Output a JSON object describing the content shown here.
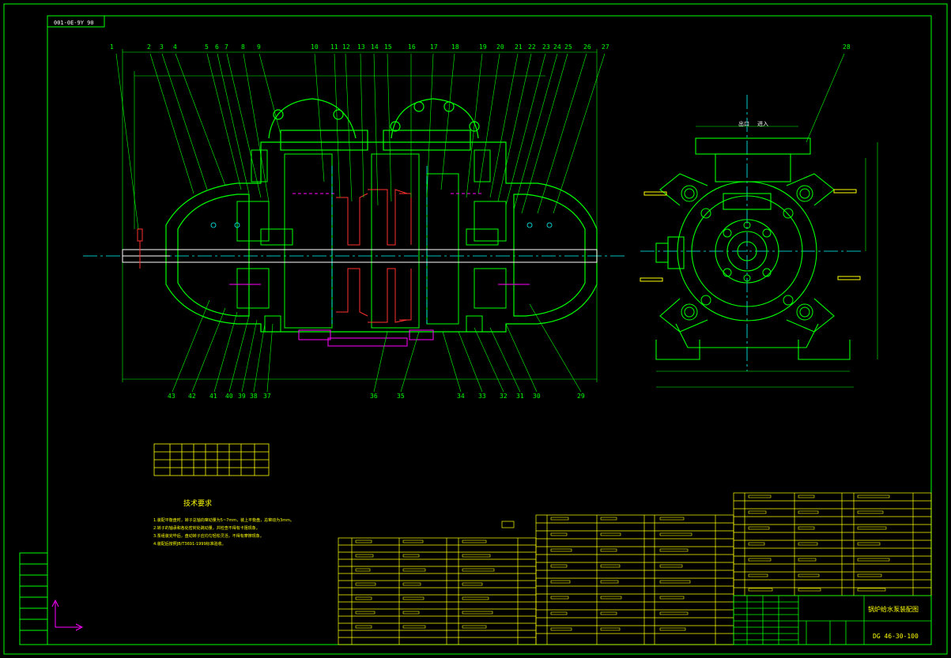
{
  "drawing": {
    "code_stamp": "001-0E-9Y  90",
    "part_number_top_row": [
      "1",
      "2",
      "3",
      "4",
      "5",
      "6",
      "7",
      "8",
      "9",
      "10",
      "11",
      "12",
      "13",
      "14",
      "15",
      "16",
      "17",
      "18",
      "19",
      "20",
      "21",
      "22",
      "23",
      "24",
      "25",
      "26",
      "27"
    ],
    "part_number_side": [
      "28"
    ],
    "part_number_bottom_row": [
      "43",
      "42",
      "41",
      "40",
      "39",
      "38",
      "37",
      "36",
      "35",
      "34",
      "33",
      "32",
      "31",
      "30",
      "29"
    ],
    "title_block_name": "锅炉给水泵装配图",
    "title_block_code": "DG 46-30-100",
    "tech_req_heading": "技术要求",
    "tech_req_lines": [
      "1.装配平衡盘时，转子总轴向窜动量为5~7mm，装上平衡盘，总窜动为3mm。",
      "2.转子的轴承和各处密封处跳动量，并检查不得有卡阻现象。",
      "3.泵组装完毕后，盘动转子应均匀轻松灵活，不得有摩擦现象。",
      "4.装配后按照JB/T3691-1999标准验收。"
    ],
    "side_view_labels": [
      "出口",
      "进入"
    ]
  },
  "colors": {
    "background": "#000000",
    "outline": "#00ff00",
    "centerline": "#00ffff",
    "text": "#ffff00",
    "hidden": "#ff00ff",
    "section": "#ff3030",
    "white": "#ffffff"
  }
}
